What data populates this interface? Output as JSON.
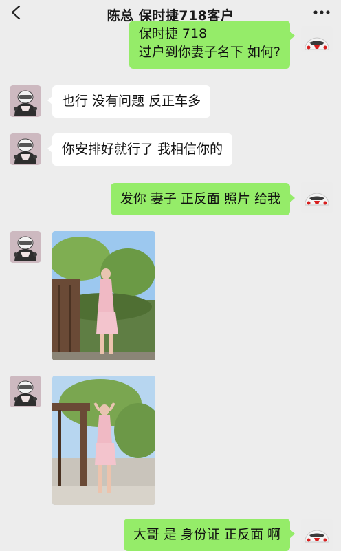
{
  "header": {
    "title": "陈总 保时捷718客户"
  },
  "messages": [
    {
      "side": "out",
      "lines": [
        "保时捷 718",
        "过户到你妻子名下 如何?"
      ]
    },
    {
      "side": "in",
      "text": "也行 没有问题 反正车多"
    },
    {
      "side": "in",
      "text": "你安排好就行了 我相信你的"
    },
    {
      "side": "out",
      "text": "发你 妻子 正反面 照片 给我"
    },
    {
      "side": "in",
      "type": "image"
    },
    {
      "side": "in",
      "type": "image"
    },
    {
      "side": "out",
      "text": "大哥 是 身份证 正反面 啊"
    }
  ],
  "colors": {
    "background": "#ededed",
    "outgoing_bubble": "#95ec69",
    "incoming_bubble": "#ffffff"
  },
  "icons": [
    "back-arrow-icon",
    "more-dots-icon",
    "contact-avatar",
    "car-avatar"
  ]
}
